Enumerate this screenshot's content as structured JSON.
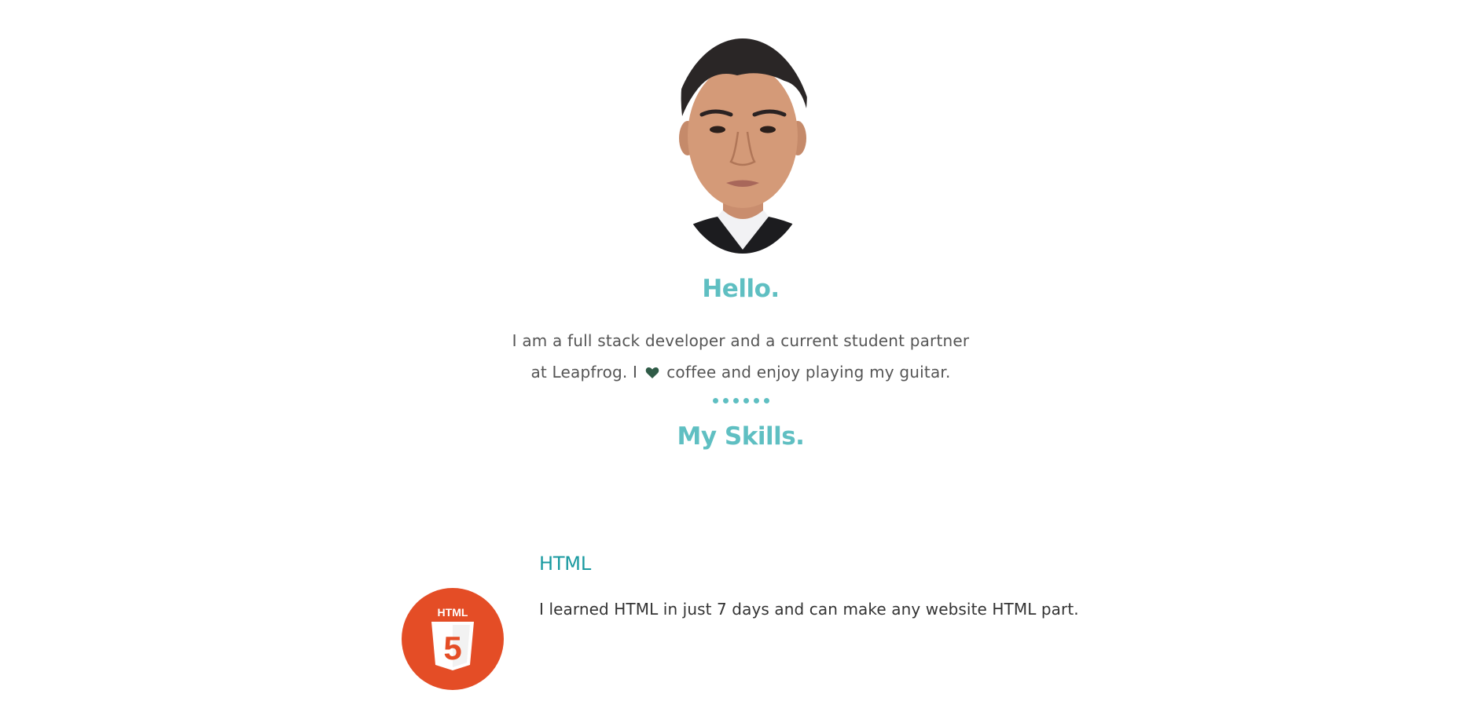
{
  "profile": {
    "avatar_alt": "profile photo"
  },
  "about": {
    "title": "Hello.",
    "line1": "I am a full stack developer and a current student partner",
    "line2_before": "at Leapfrog. I",
    "line2_after": "coffee and enjoy playing my guitar.",
    "heart_icon": "heart-icon"
  },
  "skills": {
    "title": "My Skills.",
    "items": [
      {
        "name": "HTML",
        "description": "I learned HTML in just 7 days and can make any website HTML part.",
        "logo_text": "HTML",
        "logo_number": "5",
        "logo_color": "#e44d26"
      }
    ]
  },
  "colors": {
    "accent": "#5fbfc2",
    "skill_title": "#1a9aa0",
    "body_text": "#555555"
  }
}
